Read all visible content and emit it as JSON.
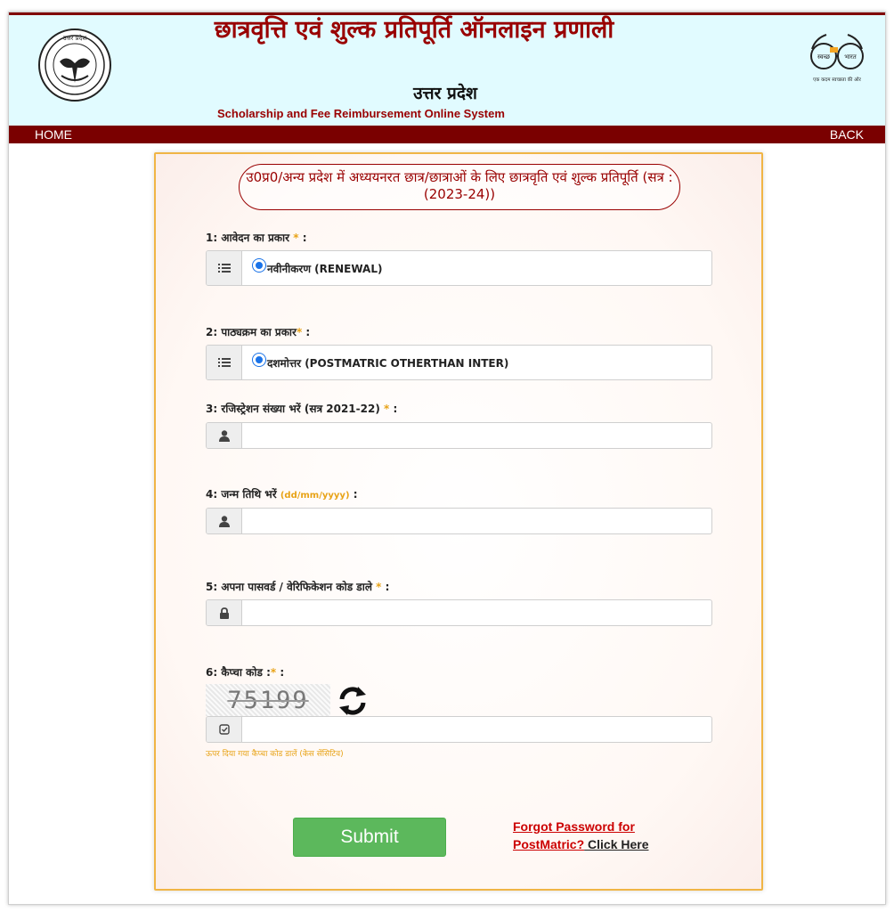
{
  "header": {
    "title_hindi": "छात्रवृत्ति एवं शुल्क प्रतिपूर्ति ऑनलाइन प्रणाली",
    "state": "उत्तर प्रदेश",
    "title_english": "Scholarship and Fee Reimbursement Online System",
    "left_logo": "up-government-seal",
    "right_logo": "swachh-bharat-logo",
    "right_logo_text_left": "स्वच्छ",
    "right_logo_text_right": "भारत",
    "right_logo_tagline": "एक कदम स्वच्छता की ओर"
  },
  "nav": {
    "home": "HOME",
    "back": "BACK"
  },
  "form": {
    "title": "उ0प्र0/अन्य प्रदेश में अध्ययनरत छात्र/छात्राओं के लिए छात्रवृति एवं शुल्क प्रतिपूर्ति (सत्र : (2023-24))",
    "q1_label": "1: आवेदन का प्रकार",
    "q1_value": "नवीनीकरण (RENEWAL)",
    "q2_label": "2: पाठ्यक्रम का प्रकार",
    "q2_value": "दशमोत्तर (POSTMATRIC OTHERTHAN INTER)",
    "q3_label": "3: रजिस्ट्रेशन संख्या भरें (सत्र 2021-22)",
    "q4_label": "4: जन्म तिथि भरें",
    "q4_hint": "(dd/mm/yyyy)",
    "q5_label": "5: अपना पासवर्ड / वेरिफिकेशन कोड डाले",
    "q6_label": "6: कैप्चा कोड :",
    "captcha_value": "75199",
    "captcha_hint": "ऊपर दिया गया कैप्चा कोड डालें (केस सेंसिटिव)",
    "required_mark": "*",
    "colon": ":",
    "submit": "Submit",
    "forgot_line1": "Forgot Password for",
    "forgot_line2_red": "PostMatric?",
    "forgot_line2_dark": " Click Here"
  },
  "colors": {
    "maroon": "#7a0000",
    "header_bg": "#e1fbff",
    "accent_orange": "#e8a317",
    "submit_green": "#5cb85c"
  }
}
